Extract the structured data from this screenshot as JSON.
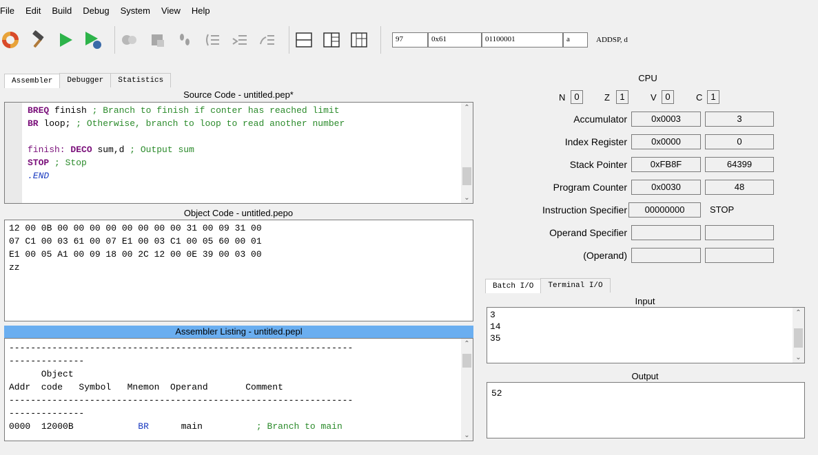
{
  "menu": [
    "File",
    "Edit",
    "Build",
    "Debug",
    "System",
    "View",
    "Help"
  ],
  "toolbar": {
    "decimal": "97",
    "hex": "0x61",
    "binary": "01100001",
    "char": "a",
    "instruction": "ADDSP, d"
  },
  "left_tabs": [
    "Assembler",
    "Debugger",
    "Statistics"
  ],
  "source": {
    "title": "Source Code - untitled.pep*",
    "lines": [
      {
        "kw": "BREQ",
        "rest": " finish ",
        "cm": "; Branch to finish if conter has reached limit"
      },
      {
        "kw": "BR",
        "rest": " loop; ",
        "cm": "; Otherwise, branch to loop to read another number"
      },
      {
        "kw": "",
        "rest": "",
        "cm": ""
      },
      {
        "lbl": "finish: ",
        "kw": "DECO",
        "rest": " sum,d ",
        "cm": "; Output sum"
      },
      {
        "kw": "STOP",
        "rest": " ",
        "cm": "; Stop"
      },
      {
        "dir": ".END"
      }
    ]
  },
  "object": {
    "title": "Object Code - untitled.pepo",
    "lines": [
      "12 00 0B 00 00 00 00 00 00 00 00 31 00 09 31 00",
      "07 C1 00 03 61 00 07 E1 00 03 C1 00 05 60 00 01",
      "E1 00 05 A1 00 09 18 00 2C 12 00 0E 39 00 03 00",
      "zz"
    ]
  },
  "listing": {
    "title": "Assembler Listing - untitled.pepl",
    "lines": [
      "----------------------------------------------------------------",
      "--------------",
      "      Object",
      "Addr  code   Symbol   Mnemon  Operand       Comment",
      "----------------------------------------------------------------",
      "--------------"
    ],
    "row": {
      "addr": "0000",
      "code": "12000B",
      "mnemon": "BR",
      "operand": "main",
      "comment": "; Branch to main"
    }
  },
  "cpu": {
    "title": "CPU",
    "flags": [
      {
        "name": "N",
        "value": "0"
      },
      {
        "name": "Z",
        "value": "1"
      },
      {
        "name": "V",
        "value": "0"
      },
      {
        "name": "C",
        "value": "1"
      }
    ],
    "registers": [
      {
        "label": "Accumulator",
        "hex": "0x0003",
        "dec": "3"
      },
      {
        "label": "Index Register",
        "hex": "0x0000",
        "dec": "0"
      },
      {
        "label": "Stack Pointer",
        "hex": "0xFB8F",
        "dec": "64399"
      },
      {
        "label": "Program Counter",
        "hex": "0x0030",
        "dec": "48"
      }
    ],
    "instruction_specifier": {
      "label": "Instruction Specifier",
      "bin": "00000000",
      "mnemonic": "STOP"
    },
    "operand_specifier": {
      "label": "Operand Specifier",
      "hex": "",
      "dec": ""
    },
    "operand": {
      "label": "(Operand)",
      "hex": "",
      "dec": ""
    }
  },
  "io_tabs": [
    "Batch I/O",
    "Terminal I/O"
  ],
  "io": {
    "input_title": "Input",
    "input_lines": [
      "3",
      "14",
      "35"
    ],
    "output_title": "Output",
    "output_lines": [
      "52"
    ]
  }
}
